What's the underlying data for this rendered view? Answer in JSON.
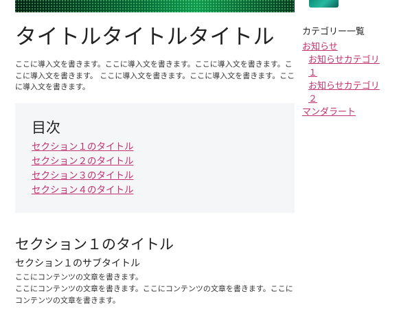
{
  "page": {
    "title": "タイトルタイトルタイトル",
    "intro": "ここに導入文を書きます。ここに導入文を書きます。ここに導入文を書きます。ここに導入文を書きます。 ここに導入文を書きます。ここに導入文を書きます。ここに導入文を書きます。"
  },
  "toc": {
    "heading": "目次",
    "items": [
      {
        "label": "セクション１のタイトル"
      },
      {
        "label": "セクション２のタイトル"
      },
      {
        "label": "セクション３のタイトル"
      },
      {
        "label": "セクション４のタイトル"
      }
    ]
  },
  "section1": {
    "title": "セクション１のタイトル",
    "subtitle": "セクション１のサブタイトル",
    "paragraphs": [
      "ここにコンテンツの文章を書きます。",
      "ここにコンテンツの文章を書きます。ここにコンテンツの文章を書きます。ここにコンテンツの文章を書きます。"
    ]
  },
  "sidebar": {
    "heading": "カテゴリー一覧",
    "categories": [
      {
        "label": "お知らせ"
      },
      {
        "label": "お知らせカテゴリ１"
      },
      {
        "label": "お知らせカテゴリ２"
      },
      {
        "label": "マンダラート"
      }
    ]
  },
  "colors": {
    "link": "#c2316f",
    "toc_background": "#f4f6f8",
    "hero": "#056a35"
  }
}
